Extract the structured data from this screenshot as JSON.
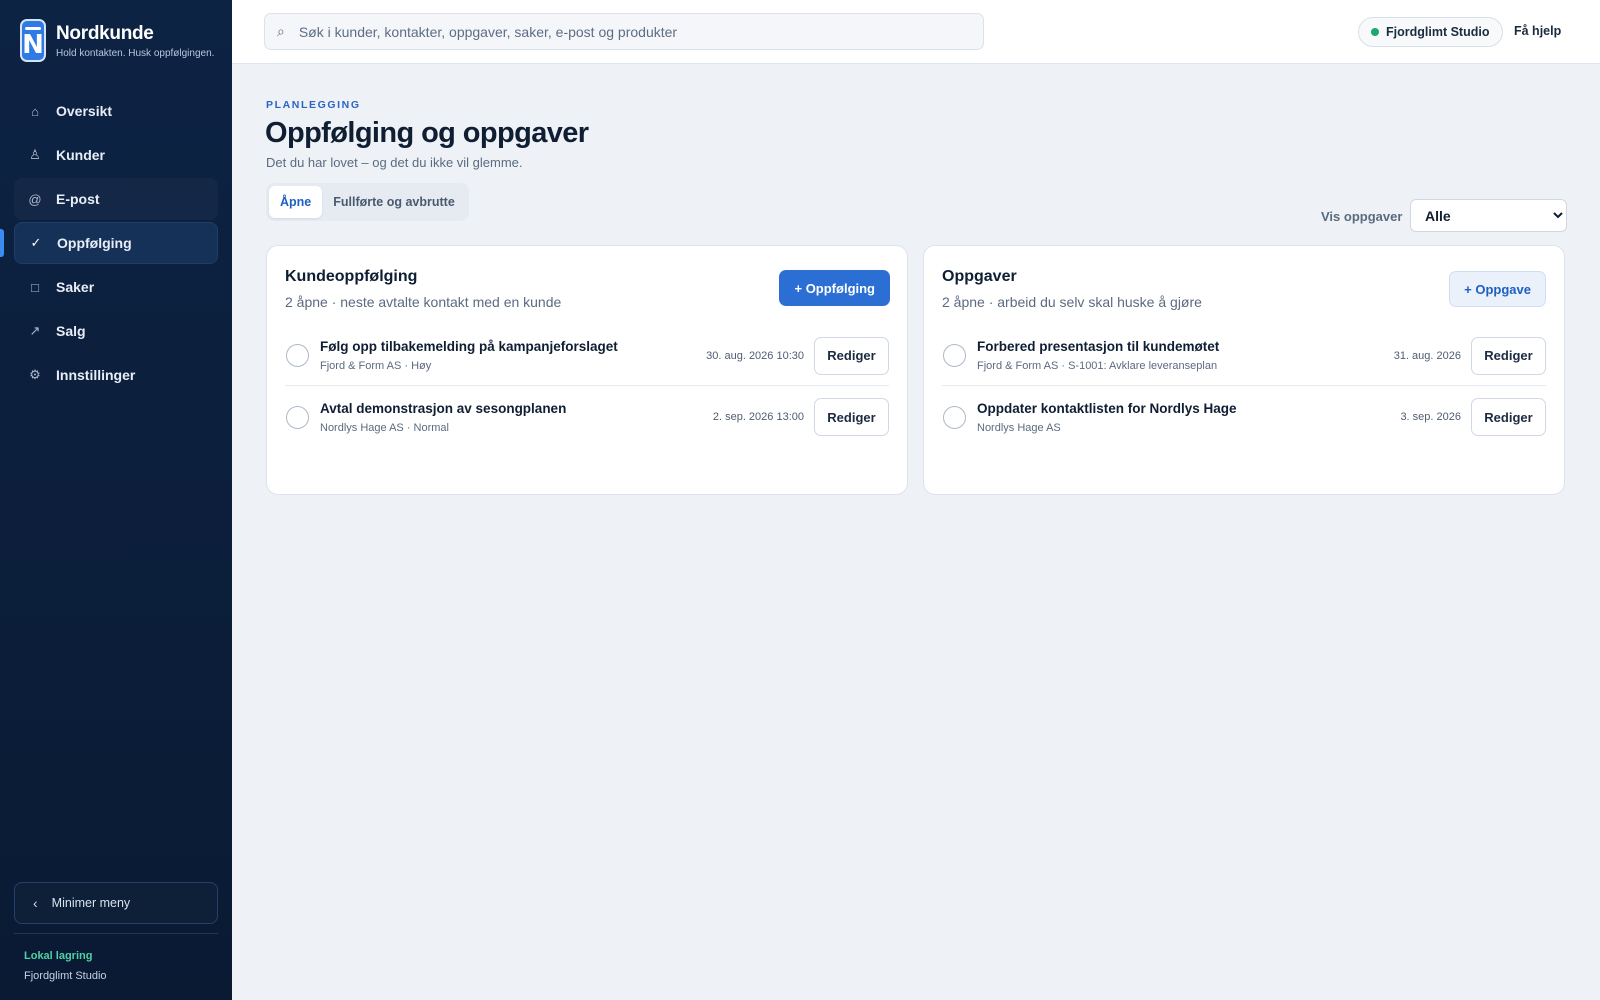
{
  "brand": {
    "logo_letter": "N",
    "name": "Nordkunde",
    "tagline": "Hold kontakten. Husk oppfølgingen."
  },
  "sidebar": {
    "items": [
      {
        "label": "Oversikt",
        "icon": "home-icon",
        "glyph": "⌂"
      },
      {
        "label": "Kunder",
        "icon": "person-icon",
        "glyph": "♙"
      },
      {
        "label": "E-post",
        "icon": "at-icon",
        "glyph": "@"
      },
      {
        "label": "Oppfølging",
        "icon": "check-icon",
        "glyph": "✓",
        "active": true
      },
      {
        "label": "Saker",
        "icon": "square-icon",
        "glyph": "□"
      },
      {
        "label": "Salg",
        "icon": "trend-arrow-icon",
        "glyph": "↗"
      },
      {
        "label": "Innstillinger",
        "icon": "gear-icon",
        "glyph": "⚙"
      }
    ],
    "collapse_label": "Minimer meny",
    "storage_title": "Lokal lagring",
    "storage_org": "Fjordglimt Studio"
  },
  "topbar": {
    "search_placeholder": "Søk i kunder, kontakter, oppgaver, saker, e-post og produkter",
    "org_name": "Fjordglimt Studio",
    "help_label": "Få hjelp"
  },
  "page": {
    "eyebrow": "PLANLEGGING",
    "title": "Oppfølging og oppgaver",
    "subtitle": "Det du har lovet – og det du ikke vil glemme.",
    "tabs": [
      {
        "label": "Åpne",
        "active": true
      },
      {
        "label": "Fullførte og avbrutte",
        "active": false
      }
    ],
    "filter_label": "Vis oppgaver",
    "filter_value": "Alle"
  },
  "followups": {
    "title": "Kundeoppfølging",
    "subtitle": "2 åpne · neste avtalte kontakt med en kunde",
    "add_label": "+ Oppfølging",
    "rows": [
      {
        "title": "Følg opp tilbakemelding på kampanjeforslaget",
        "meta": "Fjord & Form AS · Høy",
        "date": "30. aug. 2026 10:30",
        "edit": "Rediger"
      },
      {
        "title": "Avtal demonstrasjon av sesongplanen",
        "meta": "Nordlys Hage AS · Normal",
        "date": "2. sep. 2026 13:00",
        "edit": "Rediger"
      }
    ]
  },
  "tasks": {
    "title": "Oppgaver",
    "subtitle": "2 åpne · arbeid du selv skal huske å gjøre",
    "add_label": "+ Oppgave",
    "rows": [
      {
        "title": "Forbered presentasjon til kundemøtet",
        "meta": "Fjord & Form AS · S-1001: Avklare leveranseplan",
        "date": "31. aug. 2026",
        "edit": "Rediger"
      },
      {
        "title": "Oppdater kontaktlisten for Nordlys Hage",
        "meta": "Nordlys Hage AS",
        "date": "3. sep. 2026",
        "edit": "Rediger"
      }
    ]
  },
  "colors": {
    "sidebar_bg": "#0d2344",
    "accent": "#2b6fd4",
    "status_green": "#1aa872",
    "storage_green": "#4fd1a5"
  }
}
